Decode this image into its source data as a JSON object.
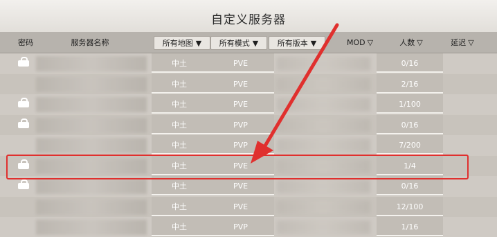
{
  "window": {
    "title": "自定义服务器"
  },
  "columns": {
    "password": "密码",
    "server_name": "服务器名称",
    "map_filter": "所有地图",
    "mode_filter": "所有模式",
    "version_filter": "所有版本",
    "mod": "MOD",
    "players": "人数",
    "latency": "延迟",
    "filter_arrow": "▼",
    "sort_arrow": "▽"
  },
  "rows": [
    {
      "locked": true,
      "map": "中土",
      "mode": "PVE",
      "players": "0/16"
    },
    {
      "locked": false,
      "map": "中土",
      "mode": "PVE",
      "players": "2/16"
    },
    {
      "locked": true,
      "map": "中土",
      "mode": "PVE",
      "players": "1/100"
    },
    {
      "locked": true,
      "map": "中土",
      "mode": "PVP",
      "players": "0/16"
    },
    {
      "locked": false,
      "map": "中土",
      "mode": "PVP",
      "players": "7/200"
    },
    {
      "locked": true,
      "map": "中土",
      "mode": "PVE",
      "players": "1/4"
    },
    {
      "locked": true,
      "map": "中土",
      "mode": "PVE",
      "players": "0/16"
    },
    {
      "locked": false,
      "map": "中土",
      "mode": "PVE",
      "players": "12/100"
    },
    {
      "locked": false,
      "map": "中土",
      "mode": "PVP",
      "players": "1/16"
    }
  ],
  "annotation": {
    "highlight_color": "#e0302e",
    "highlighted_row": 6
  }
}
